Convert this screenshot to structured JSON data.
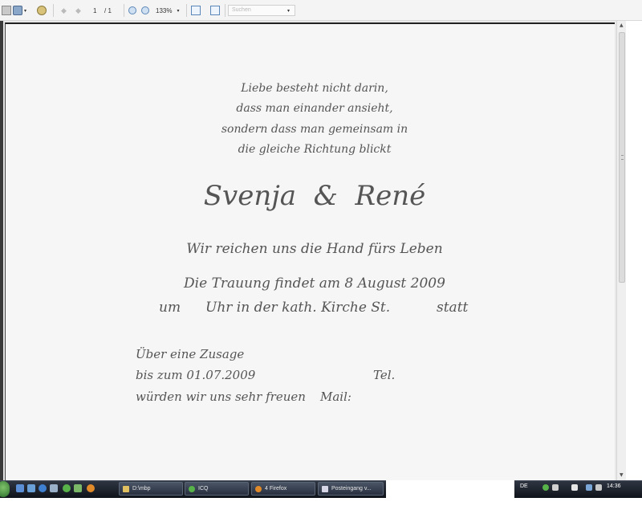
{
  "toolbar": {
    "page_current": "1",
    "page_total": "/ 1",
    "zoom": "133%",
    "search_placeholder": "Suchen",
    "icons": [
      "print-icon",
      "save-icon",
      "prev-page-icon",
      "next-page-icon",
      "zoom-out-icon",
      "zoom-in-icon",
      "fit-page-icon",
      "fit-width-icon"
    ]
  },
  "document": {
    "quote": [
      "Liebe besteht nicht darin,",
      "dass man einander ansieht,",
      "sondern dass man gemeinsam in",
      "die gleiche Richtung blickt"
    ],
    "names": "Svenja  &  René",
    "tagline": "Wir reichen uns die Hand fürs Leben",
    "ceremony_line1": "Die Trauung findet am 8 August 2009",
    "ceremony_line2_a": "um",
    "ceremony_line2_b": "Uhr in der kath. Kirche St.",
    "ceremony_line2_c": "statt",
    "rsvp_line1": "Über eine Zusage",
    "rsvp_line2": "bis zum 01.07.2009",
    "rsvp_tel": "Tel.",
    "rsvp_line3": "würden wir uns sehr freuen",
    "rsvp_mail": "Mail:"
  },
  "taskbar": {
    "tasks": [
      {
        "label": "D:\\mbp"
      },
      {
        "label": "ICQ"
      },
      {
        "label": "4 Firefox"
      },
      {
        "label": "Posteingang v..."
      }
    ],
    "language": "DE",
    "clock": "14:36"
  },
  "colors": {
    "script_text": "#555555",
    "taskbar": "#1c222c",
    "page": "#f6f6f6"
  }
}
